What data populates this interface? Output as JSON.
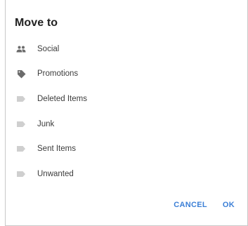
{
  "dialog": {
    "title": "Move to",
    "folders": [
      {
        "label": "Social",
        "icon": "people-icon"
      },
      {
        "label": "Promotions",
        "icon": "tag-icon"
      },
      {
        "label": "Deleted Items",
        "icon": "label-icon"
      },
      {
        "label": "Junk",
        "icon": "label-icon"
      },
      {
        "label": "Sent Items",
        "icon": "label-icon"
      },
      {
        "label": "Unwanted",
        "icon": "label-icon"
      }
    ],
    "cancel_label": "CANCEL",
    "ok_label": "OK"
  },
  "colors": {
    "accent": "#3b7fd6",
    "icon_dark": "#6b6b6b",
    "icon_light": "#cfcfcf"
  }
}
